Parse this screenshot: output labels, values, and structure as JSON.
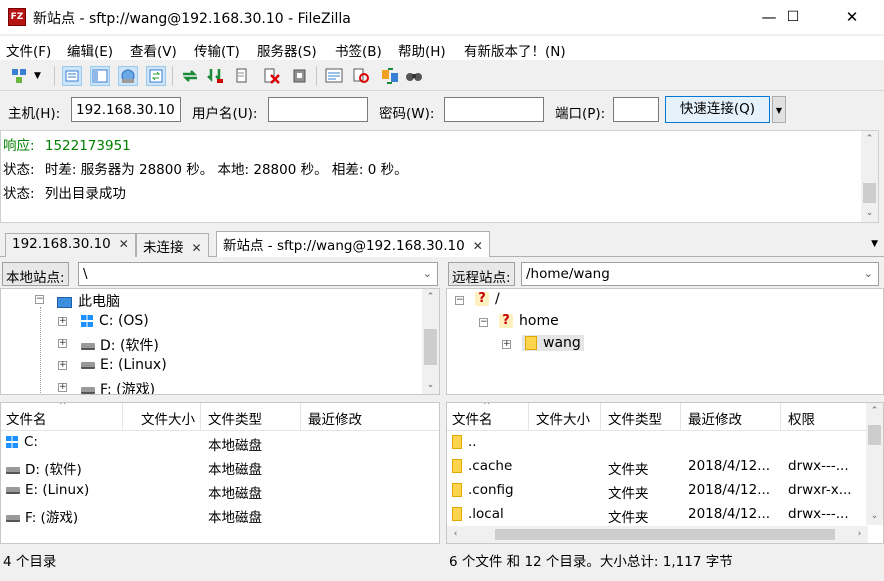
{
  "window": {
    "title": "新站点 - sftp://wang@192.168.30.10 - FileZilla",
    "app_icon_text": "FZ",
    "minimize": "—",
    "maximize": "☐",
    "close": "✕"
  },
  "menu": [
    "文件(F)",
    "编辑(E)",
    "查看(V)",
    "传输(T)",
    "服务器(S)",
    "书签(B)",
    "帮助(H)",
    "有新版本了！(N)"
  ],
  "quickconnect": {
    "host_label": "主机(H):",
    "host_value": "192.168.30.10",
    "user_label": "用户名(U):",
    "user_value": "",
    "pass_label": "密码(W):",
    "pass_value": "",
    "port_label": "端口(P):",
    "port_value": "",
    "connect_label": "快速连接(Q)"
  },
  "log": [
    {
      "prefix": "响应:",
      "text": "1522173951",
      "color": "#008000"
    },
    {
      "prefix": "状态:",
      "text": "时差: 服务器为 28800 秒。 本地: 28800 秒。 相差: 0 秒。",
      "color": "#000000"
    },
    {
      "prefix": "状态:",
      "text": "列出目录成功",
      "color": "#000000"
    }
  ],
  "tabs": [
    {
      "label": "192.168.30.10",
      "close": "✕"
    },
    {
      "label": "未连接",
      "close": "✕"
    },
    {
      "label": "新站点 - sftp://wang@192.168.30.10",
      "close": "✕"
    }
  ],
  "local": {
    "site_label": "本地站点:",
    "path": "\\",
    "tree": [
      {
        "label": "此电脑",
        "expander": "−"
      },
      {
        "label": "C: (OS)",
        "expander": "+"
      },
      {
        "label": "D: (软件)",
        "expander": "+"
      },
      {
        "label": "E: (Linux)",
        "expander": "+"
      },
      {
        "label": "F: (游戏)",
        "expander": "+"
      }
    ],
    "columns": [
      "文件名",
      "文件大小",
      "文件类型",
      "最近修改"
    ],
    "rows": [
      {
        "name": "C:",
        "size": "",
        "type": "本地磁盘",
        "modified": ""
      },
      {
        "name": "D: (软件)",
        "size": "",
        "type": "本地磁盘",
        "modified": ""
      },
      {
        "name": "E: (Linux)",
        "size": "",
        "type": "本地磁盘",
        "modified": ""
      },
      {
        "name": "F: (游戏)",
        "size": "",
        "type": "本地磁盘",
        "modified": ""
      }
    ],
    "status": "4 个目录"
  },
  "remote": {
    "site_label": "远程站点:",
    "path": "/home/wang",
    "tree": [
      {
        "label": "/",
        "expander": "−"
      },
      {
        "label": "home",
        "expander": "−"
      },
      {
        "label": "wang",
        "expander": "+"
      }
    ],
    "columns": [
      "文件名",
      "文件大小",
      "文件类型",
      "最近修改",
      "权限"
    ],
    "rows": [
      {
        "name": "..",
        "size": "",
        "type": "",
        "modified": "",
        "perm": ""
      },
      {
        "name": ".cache",
        "size": "",
        "type": "文件夹",
        "modified": "2018/4/12...",
        "perm": "drwx---..."
      },
      {
        "name": ".config",
        "size": "",
        "type": "文件夹",
        "modified": "2018/4/12...",
        "perm": "drwxr-x..."
      },
      {
        "name": ".local",
        "size": "",
        "type": "文件夹",
        "modified": "2018/4/12...",
        "perm": "drwx---..."
      }
    ],
    "status": "6 个文件 和 12 个目录。大小总计: 1,117 字节"
  }
}
